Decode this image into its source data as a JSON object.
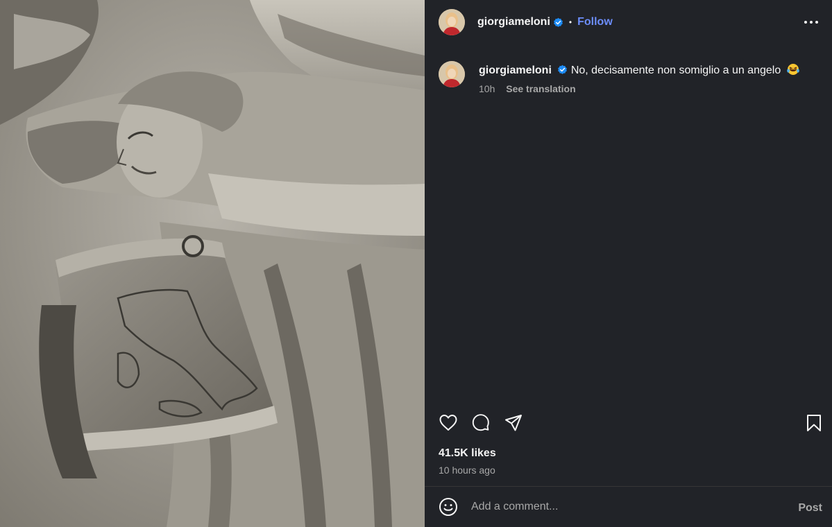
{
  "header": {
    "username": "giorgiameloni",
    "separator": "•",
    "follow_label": "Follow"
  },
  "caption": {
    "username": "giorgiameloni",
    "text": "No, decisamente non somiglio a un angelo",
    "time": "10h",
    "see_translation": "See translation"
  },
  "stats": {
    "likes": "41.5K likes",
    "posted": "10 hours ago"
  },
  "comment": {
    "placeholder": "Add a comment...",
    "post_label": "Post"
  },
  "colors": {
    "panel_bg": "#212328",
    "accent_link": "#6c8dfa",
    "verified": "#1e8cf5",
    "muted_text": "#a8a8a8"
  },
  "icons": [
    "verified-badge-icon",
    "more-options-icon",
    "heart-icon",
    "comment-icon",
    "share-icon",
    "bookmark-icon",
    "emoji-icon",
    "laughing-emoji"
  ]
}
